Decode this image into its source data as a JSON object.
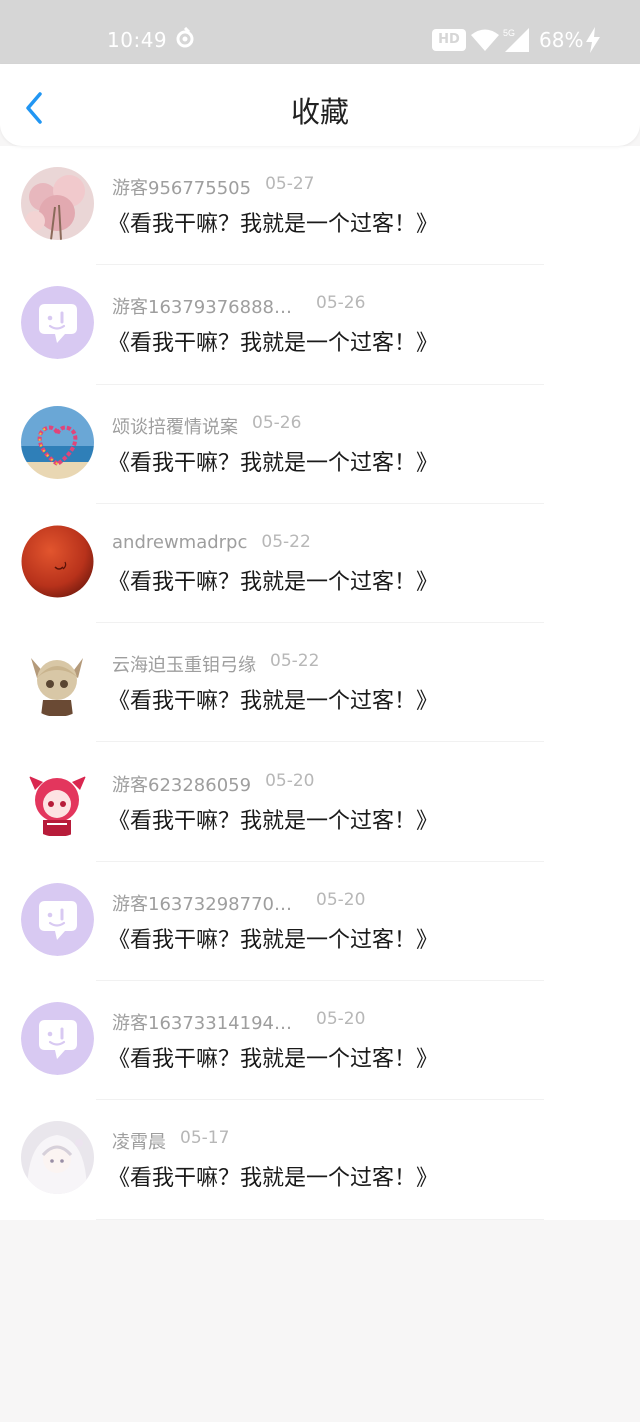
{
  "status_bar": {
    "time": "10:49",
    "hd": "HD",
    "network": "5G",
    "battery": "68%"
  },
  "header": {
    "back_icon": "chevron-left-icon",
    "title": "收藏"
  },
  "colors": {
    "accent": "#2196f3",
    "avatar_default": "#d8c9f2"
  },
  "favorites": [
    {
      "user": "游客956775505",
      "date": "05-27",
      "content": "《看我干嘛？我就是一个过客！》",
      "avatar": "pink-flowers"
    },
    {
      "user": "游客163793768880…",
      "date": "05-26",
      "content": "《看我干嘛？我就是一个过客！》",
      "avatar": "default-chat"
    },
    {
      "user": "颂谈掊覆情说案",
      "date": "05-26",
      "content": "《看我干嘛？我就是一个过客！》",
      "avatar": "heart-beach"
    },
    {
      "user": "andrewmadrpc",
      "date": "05-22",
      "content": "《看我干嘛？我就是一个过客！》",
      "avatar": "red-ball"
    },
    {
      "user": "云海迫玉重钼弓缘",
      "date": "05-22",
      "content": "《看我干嘛？我就是一个过客！》",
      "avatar": "anime-fox"
    },
    {
      "user": "游客623286059",
      "date": "05-20",
      "content": "《看我干嘛？我就是一个过客！》",
      "avatar": "anime-red"
    },
    {
      "user": "游客163732987701…",
      "date": "05-20",
      "content": "《看我干嘛？我就是一个过客！》",
      "avatar": "default-chat"
    },
    {
      "user": "游客163733141948…",
      "date": "05-20",
      "content": "《看我干嘛？我就是一个过客！》",
      "avatar": "default-chat"
    },
    {
      "user": "凌霄晨",
      "date": "05-17",
      "content": "《看我干嘛？我就是一个过客！》",
      "avatar": "anime-white"
    }
  ]
}
